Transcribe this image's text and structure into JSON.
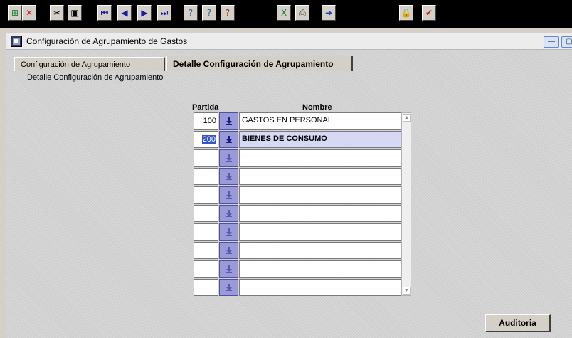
{
  "toolbar": {
    "buttons": [
      {
        "name": "insert-record-icon",
        "glyph": "⊞",
        "color": "#1a8a2a"
      },
      {
        "name": "delete-record-icon",
        "glyph": "✕",
        "color": "#cc2222"
      },
      {
        "name": "cut-icon",
        "glyph": "✂",
        "color": "#000000"
      },
      {
        "name": "save-icon",
        "glyph": "▣",
        "color": "#000000"
      },
      {
        "name": "first-record-icon",
        "glyph": "⏮",
        "color": "#1a1aa8"
      },
      {
        "name": "previous-record-icon",
        "glyph": "◀",
        "color": "#1a1aa8"
      },
      {
        "name": "next-record-icon",
        "glyph": "▶",
        "color": "#1a1aa8"
      },
      {
        "name": "last-record-icon",
        "glyph": "⏭",
        "color": "#1a1aa8"
      },
      {
        "name": "query-enter-icon",
        "glyph": "?",
        "color": "#2b5d8a"
      },
      {
        "name": "query-execute-icon",
        "glyph": "?",
        "color": "#2b5d8a"
      },
      {
        "name": "query-cancel-icon",
        "glyph": "?",
        "color": "#aa2222"
      },
      {
        "name": "export-excel-icon",
        "glyph": "X",
        "color": "#1a7a3a"
      },
      {
        "name": "print-icon",
        "glyph": "⎙",
        "color": "#333333"
      },
      {
        "name": "exit-icon",
        "glyph": "➜",
        "color": "#2244aa"
      },
      {
        "name": "lock-icon",
        "glyph": "🔒",
        "color": "#b89a20"
      },
      {
        "name": "checkbox-icon",
        "glyph": "✔",
        "color": "#cc2222"
      }
    ]
  },
  "window": {
    "title": "Configuración de Agrupamiento de Gastos"
  },
  "tabs": [
    {
      "label": "Configuración de Agrupamiento",
      "active": false
    },
    {
      "label": "Detalle Configuración de Agrupamiento",
      "active": true
    }
  ],
  "section_label": "Detalle Configuración de Agrupamiento",
  "grid": {
    "headers": {
      "partida": "Partida",
      "nombre": "Nombre"
    },
    "rows": [
      {
        "partida": "100",
        "nombre": "GASTOS EN PERSONAL"
      },
      {
        "partida": "200",
        "nombre": "BIENES DE CONSUMO"
      },
      {
        "partida": "",
        "nombre": ""
      },
      {
        "partida": "",
        "nombre": ""
      },
      {
        "partida": "",
        "nombre": ""
      },
      {
        "partida": "",
        "nombre": ""
      },
      {
        "partida": "",
        "nombre": ""
      },
      {
        "partida": "",
        "nombre": ""
      },
      {
        "partida": "",
        "nombre": ""
      },
      {
        "partida": "",
        "nombre": ""
      }
    ],
    "selected_row": 1
  },
  "buttons": {
    "auditoria": "Auditoria"
  }
}
